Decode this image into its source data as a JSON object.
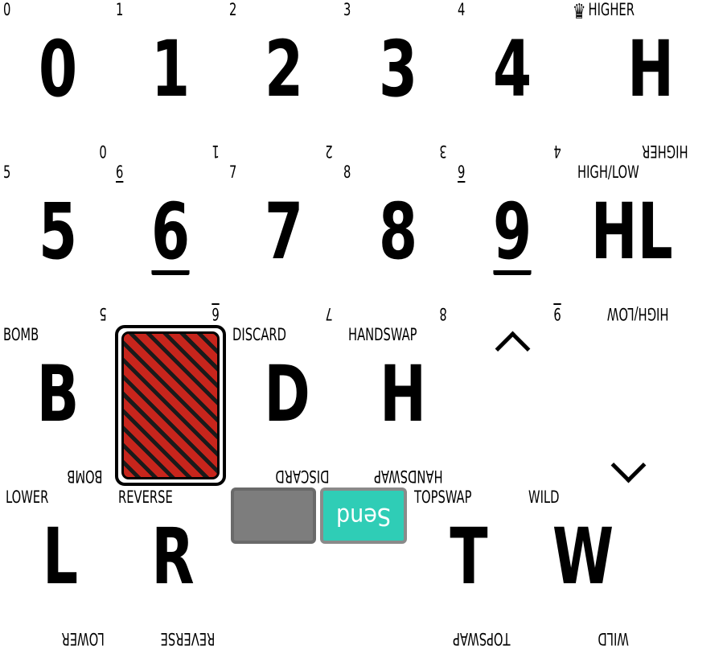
{
  "cards": [
    {
      "corner": "0",
      "big": "0"
    },
    {
      "corner": "1",
      "big": "1"
    },
    {
      "corner": "2",
      "big": "2"
    },
    {
      "corner": "3",
      "big": "3"
    },
    {
      "corner": "4",
      "big": "4"
    },
    {
      "corner": "HIGHER",
      "big": "H"
    },
    {
      "corner": "5",
      "big": "5"
    },
    {
      "corner": "6",
      "big": "6"
    },
    {
      "corner": "7",
      "big": "7"
    },
    {
      "corner": "8",
      "big": "8"
    },
    {
      "corner": "9",
      "big": "9"
    },
    {
      "corner": "HIGH/LOW",
      "big": "HL"
    },
    {
      "corner": "BOMB",
      "big": "B"
    },
    {
      "corner": "DISCARD",
      "big": "D"
    },
    {
      "corner": "HANDSWAP",
      "big": "H"
    },
    {
      "corner": "LOWER",
      "big": "L"
    },
    {
      "corner": "REVERSE",
      "big": "R"
    },
    {
      "corner": "TOPSWAP",
      "big": "T"
    },
    {
      "corner": "WILD",
      "big": "W"
    }
  ],
  "crown_icon": "crown-icon",
  "send_button": {
    "label": "Send"
  },
  "blank_button": {
    "label": ""
  },
  "scroll_up_icon": "chevron-up-icon",
  "scroll_down_icon": "chevron-down-icon",
  "colors": {
    "deck_red": "#c7251c",
    "deck_stripe": "#1a1a1a",
    "send_bg": "#2fcdb6",
    "blank_bg": "#7d7d7d"
  }
}
